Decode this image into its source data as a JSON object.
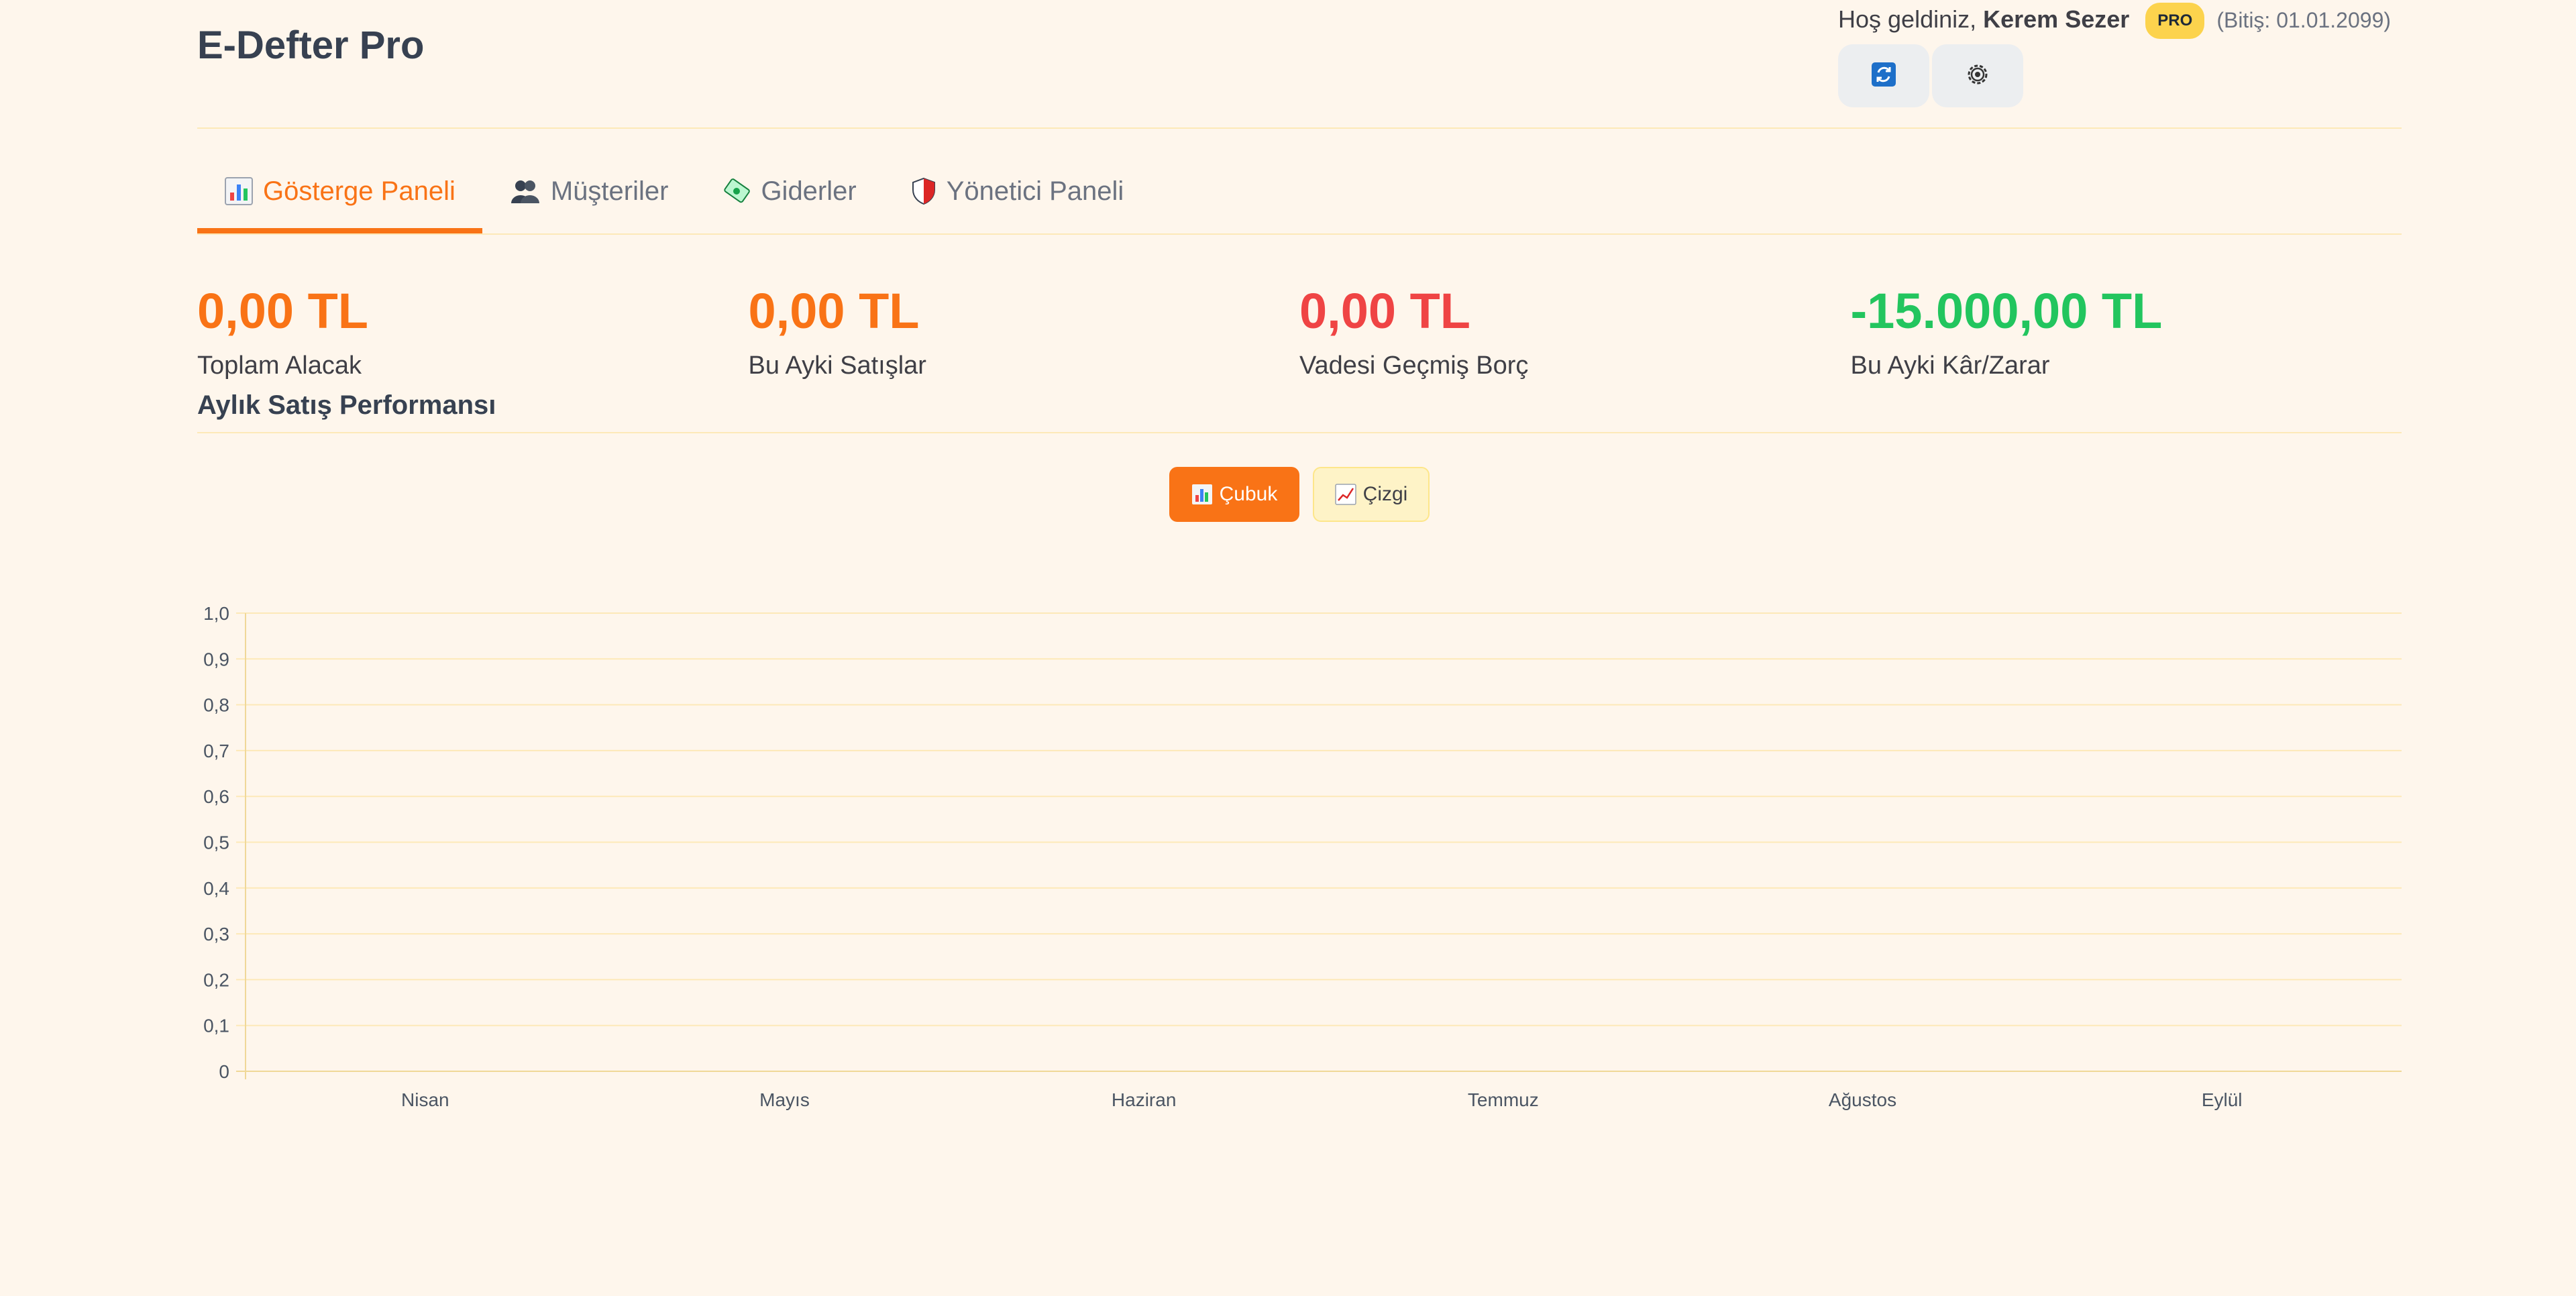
{
  "header": {
    "app_title": "E-Defter Pro",
    "welcome_prefix": "Hoş geldiniz,",
    "user_name": "Kerem Sezer",
    "plan_badge": "PRO",
    "expiry": "(Bitiş: 01.01.2099)",
    "buttons": [
      {
        "icon": "refresh-icon"
      },
      {
        "icon": "gear-icon"
      }
    ]
  },
  "tabs": [
    {
      "label": "Gösterge Paneli",
      "icon": "bar-chart-icon",
      "active": true
    },
    {
      "label": "Müşteriler",
      "icon": "users-icon",
      "active": false
    },
    {
      "label": "Giderler",
      "icon": "money-icon",
      "active": false
    },
    {
      "label": "Yönetici Paneli",
      "icon": "shield-icon",
      "active": false
    }
  ],
  "kpis": [
    {
      "value": "0,00 TL",
      "label": "Toplam Alacak",
      "color": "#f97316"
    },
    {
      "value": "0,00 TL",
      "label": "Bu Ayki Satışlar",
      "color": "#f97316"
    },
    {
      "value": "0,00 TL",
      "label": "Vadesi Geçmiş Borç",
      "color": "#ef4444"
    },
    {
      "value": "-15.000,00 TL",
      "label": "Bu Ayki Kâr/Zarar",
      "color": "#22c55e"
    }
  ],
  "section_title": "Aylık Satış Performansı",
  "chart_toggle": {
    "bar_label": "Çubuk",
    "line_label": "Çizgi",
    "selected": "bar"
  },
  "chart_data": {
    "type": "bar",
    "categories": [
      "Nisan",
      "Mayıs",
      "Haziran",
      "Temmuz",
      "Ağustos",
      "Eylül"
    ],
    "series": [
      {
        "values": [
          0,
          0,
          0,
          0,
          0,
          0
        ]
      }
    ],
    "ylim": [
      0,
      1
    ],
    "yticks": [
      "0",
      "0,1",
      "0,2",
      "0,3",
      "0,4",
      "0,5",
      "0,6",
      "0,7",
      "0,8",
      "0,9",
      "1,0"
    ],
    "grid": true,
    "title": "",
    "xlabel": "",
    "ylabel": ""
  },
  "colors": {
    "accent": "#f97316",
    "grid": "#fde9b8",
    "background": "#fef6ec"
  }
}
